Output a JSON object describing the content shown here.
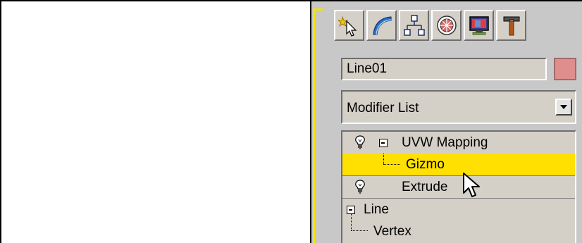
{
  "command_panel": {
    "tabs": [
      {
        "icon": "create-icon"
      },
      {
        "icon": "modify-icon"
      },
      {
        "icon": "hierarchy-icon"
      },
      {
        "icon": "motion-icon"
      },
      {
        "icon": "display-icon"
      },
      {
        "icon": "utilities-icon"
      }
    ],
    "object_name": "Line01",
    "object_color": "#e08d8d",
    "modifier_list": {
      "selected": "Modifier List"
    },
    "stack": {
      "items": [
        {
          "label": "UVW Mapping",
          "type": "modifier",
          "expanded": true
        },
        {
          "label": "Gizmo",
          "type": "sub-object",
          "selected": true
        },
        {
          "label": "Extrude",
          "type": "modifier"
        },
        {
          "label": "Line",
          "type": "base-object",
          "expanded": true
        },
        {
          "label": "Vertex",
          "type": "sub-object"
        }
      ]
    }
  },
  "colors": {
    "accent_highlight": "#ffe000",
    "viewport_border": "#f2e400",
    "panel_bg": "#c8c8c8"
  }
}
